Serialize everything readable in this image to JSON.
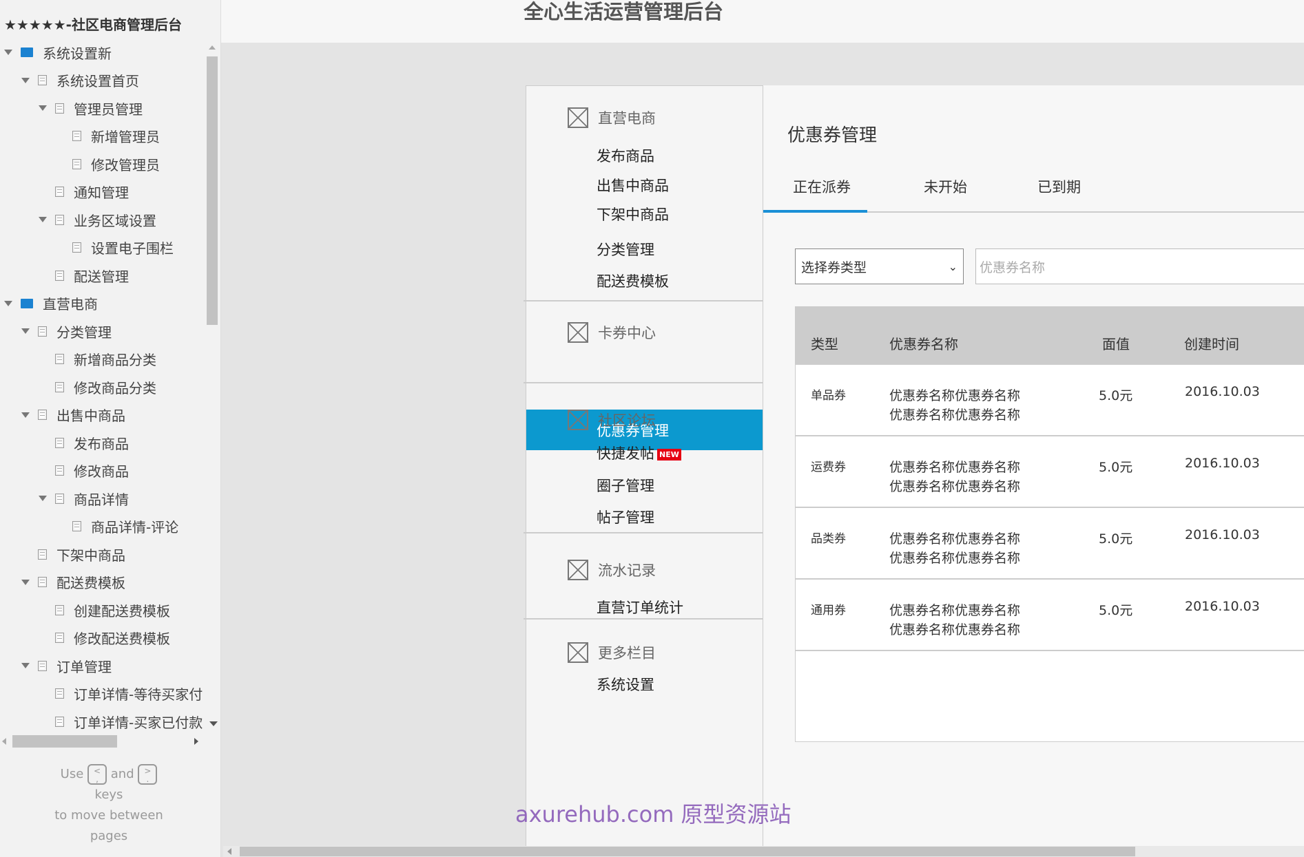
{
  "sidebar": {
    "title": "★★★★★-社区电商管理后台",
    "tree": [
      {
        "label": "系统设置新",
        "level": 0,
        "type": "folder",
        "expanded": true
      },
      {
        "label": "系统设置首页",
        "level": 1,
        "type": "page",
        "expanded": true
      },
      {
        "label": "管理员管理",
        "level": 2,
        "type": "page",
        "expanded": true
      },
      {
        "label": "新增管理员",
        "level": 3,
        "type": "page"
      },
      {
        "label": "修改管理员",
        "level": 3,
        "type": "page"
      },
      {
        "label": "通知管理",
        "level": 2,
        "type": "page"
      },
      {
        "label": "业务区域设置",
        "level": 2,
        "type": "page",
        "expanded": true
      },
      {
        "label": "设置电子围栏",
        "level": 3,
        "type": "page"
      },
      {
        "label": "配送管理",
        "level": 2,
        "type": "page"
      },
      {
        "label": "直营电商",
        "level": 0,
        "type": "folder",
        "expanded": true
      },
      {
        "label": "分类管理",
        "level": 1,
        "type": "page",
        "expanded": true
      },
      {
        "label": "新增商品分类",
        "level": 2,
        "type": "page"
      },
      {
        "label": "修改商品分类",
        "level": 2,
        "type": "page"
      },
      {
        "label": "出售中商品",
        "level": 1,
        "type": "page",
        "expanded": true
      },
      {
        "label": "发布商品",
        "level": 2,
        "type": "page"
      },
      {
        "label": "修改商品",
        "level": 2,
        "type": "page"
      },
      {
        "label": "商品详情",
        "level": 2,
        "type": "page",
        "expanded": true
      },
      {
        "label": "商品详情-评论",
        "level": 3,
        "type": "page"
      },
      {
        "label": "下架中商品",
        "level": 1,
        "type": "page"
      },
      {
        "label": "配送费模板",
        "level": 1,
        "type": "page",
        "expanded": true
      },
      {
        "label": "创建配送费模板",
        "level": 2,
        "type": "page"
      },
      {
        "label": "修改配送费模板",
        "level": 2,
        "type": "page"
      },
      {
        "label": "订单管理",
        "level": 1,
        "type": "page",
        "expanded": true
      },
      {
        "label": "订单详情-等待买家付",
        "level": 2,
        "type": "page"
      },
      {
        "label": "订单详情-买家已付款",
        "level": 2,
        "type": "page"
      }
    ],
    "help": {
      "use": "Use",
      "key_prev": "<\n,",
      "and": "and",
      "key_next": ">\n.",
      "keys": "keys",
      "line2": "to move between",
      "line3": "pages"
    }
  },
  "header": {
    "title": "全心生活运营管理后台"
  },
  "menu": {
    "sections": [
      {
        "title": "直营电商",
        "items": [
          "发布商品",
          "出售中商品",
          "下架中商品",
          "分类管理",
          "配送费模板"
        ]
      },
      {
        "title": "卡券中心",
        "items": [
          "优惠券管理"
        ],
        "active": "优惠券管理"
      },
      {
        "title": "社区论坛",
        "items": [
          "快捷发帖",
          "圈子管理",
          "帖子管理"
        ],
        "badge": "NEW"
      },
      {
        "title": "流水记录",
        "items": [
          "直营订单统计"
        ]
      },
      {
        "title": "更多栏目",
        "items": [
          "系统设置"
        ]
      }
    ],
    "accent": "#0c99cf"
  },
  "content": {
    "title": "优惠券管理",
    "tabs": [
      "正在派券",
      "未开始",
      "已到期"
    ],
    "active_tab": "正在派券",
    "select": {
      "value": "选择券类型"
    },
    "search": {
      "placeholder": "优惠券名称"
    },
    "table": {
      "headers": [
        "类型",
        "优惠券名称",
        "面值",
        "创建时间"
      ],
      "rows": [
        {
          "type": "单品券",
          "name1": "优惠券名称优惠券名称",
          "name2": "优惠券名称优惠券名称",
          "value": "5.0元",
          "created": "2016.10.03"
        },
        {
          "type": "运费券",
          "name1": "优惠券名称优惠券名称",
          "name2": "优惠券名称优惠券名称",
          "value": "5.0元",
          "created": "2016.10.03"
        },
        {
          "type": "品类券",
          "name1": "优惠券名称优惠券名称",
          "name2": "优惠券名称优惠券名称",
          "value": "5.0元",
          "created": "2016.10.03"
        },
        {
          "type": "通用券",
          "name1": "优惠券名称优惠券名称",
          "name2": "优惠券名称优惠券名称",
          "value": "5.0元",
          "created": "2016.10.03"
        }
      ]
    },
    "tab_color": "#1a8fd6"
  },
  "watermark": "axurehub.com 原型资源站"
}
